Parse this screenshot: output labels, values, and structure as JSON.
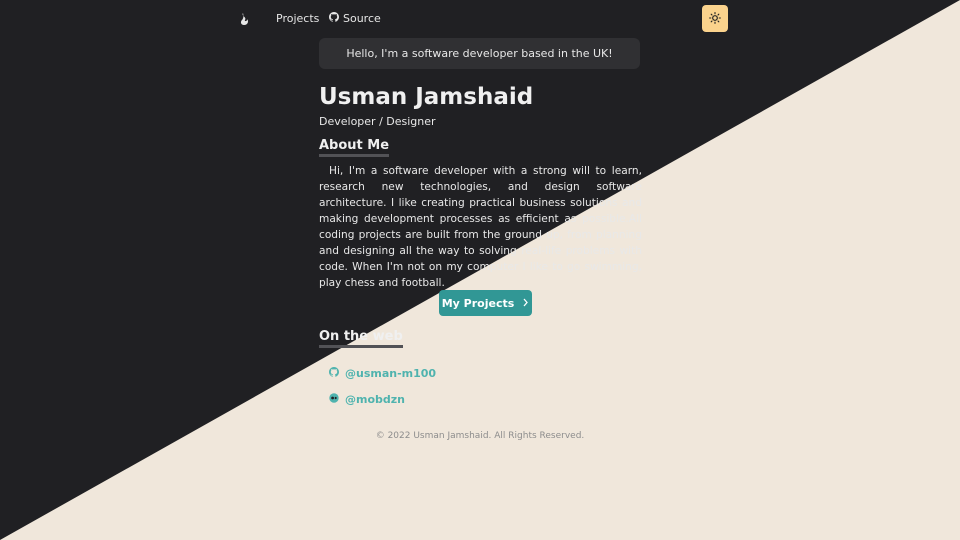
{
  "nav": {
    "projects_label": "Projects",
    "source_label": "Source",
    "logo_icon": "flame-logo-icon",
    "theme_icon": "sun-icon"
  },
  "hero": {
    "hello": "Hello, I'm a software developer based in the UK!",
    "name": "Usman Jamshaid",
    "role": "Developer / Designer"
  },
  "about": {
    "title": "About Me",
    "text": "Hi, I'm a software developer with a strong will to learn, research new technologies, and design software architecture. I like creating practical business solutions and making development processes as efficient as possible.All coding projects are built from the ground up, from planning and designing all the way to solving real-life problems with code. When I'm not on my computer I like to go swimming, play chess and football."
  },
  "projects_button": {
    "label": "My Projects",
    "icon": "chevron-right-icon"
  },
  "web": {
    "title": "On the web",
    "links": [
      {
        "label": "@usman-m100",
        "icon": "github-icon"
      },
      {
        "label": "@mobdzn",
        "icon": "medium-icon"
      }
    ]
  },
  "footer": {
    "text": "© 2022 Usman Jamshaid. All Rights Reserved."
  },
  "colors": {
    "dark_bg": "#202023",
    "light_bg": "#f0e7db",
    "accent": "#319795",
    "theme_button": "#fbd38d"
  }
}
